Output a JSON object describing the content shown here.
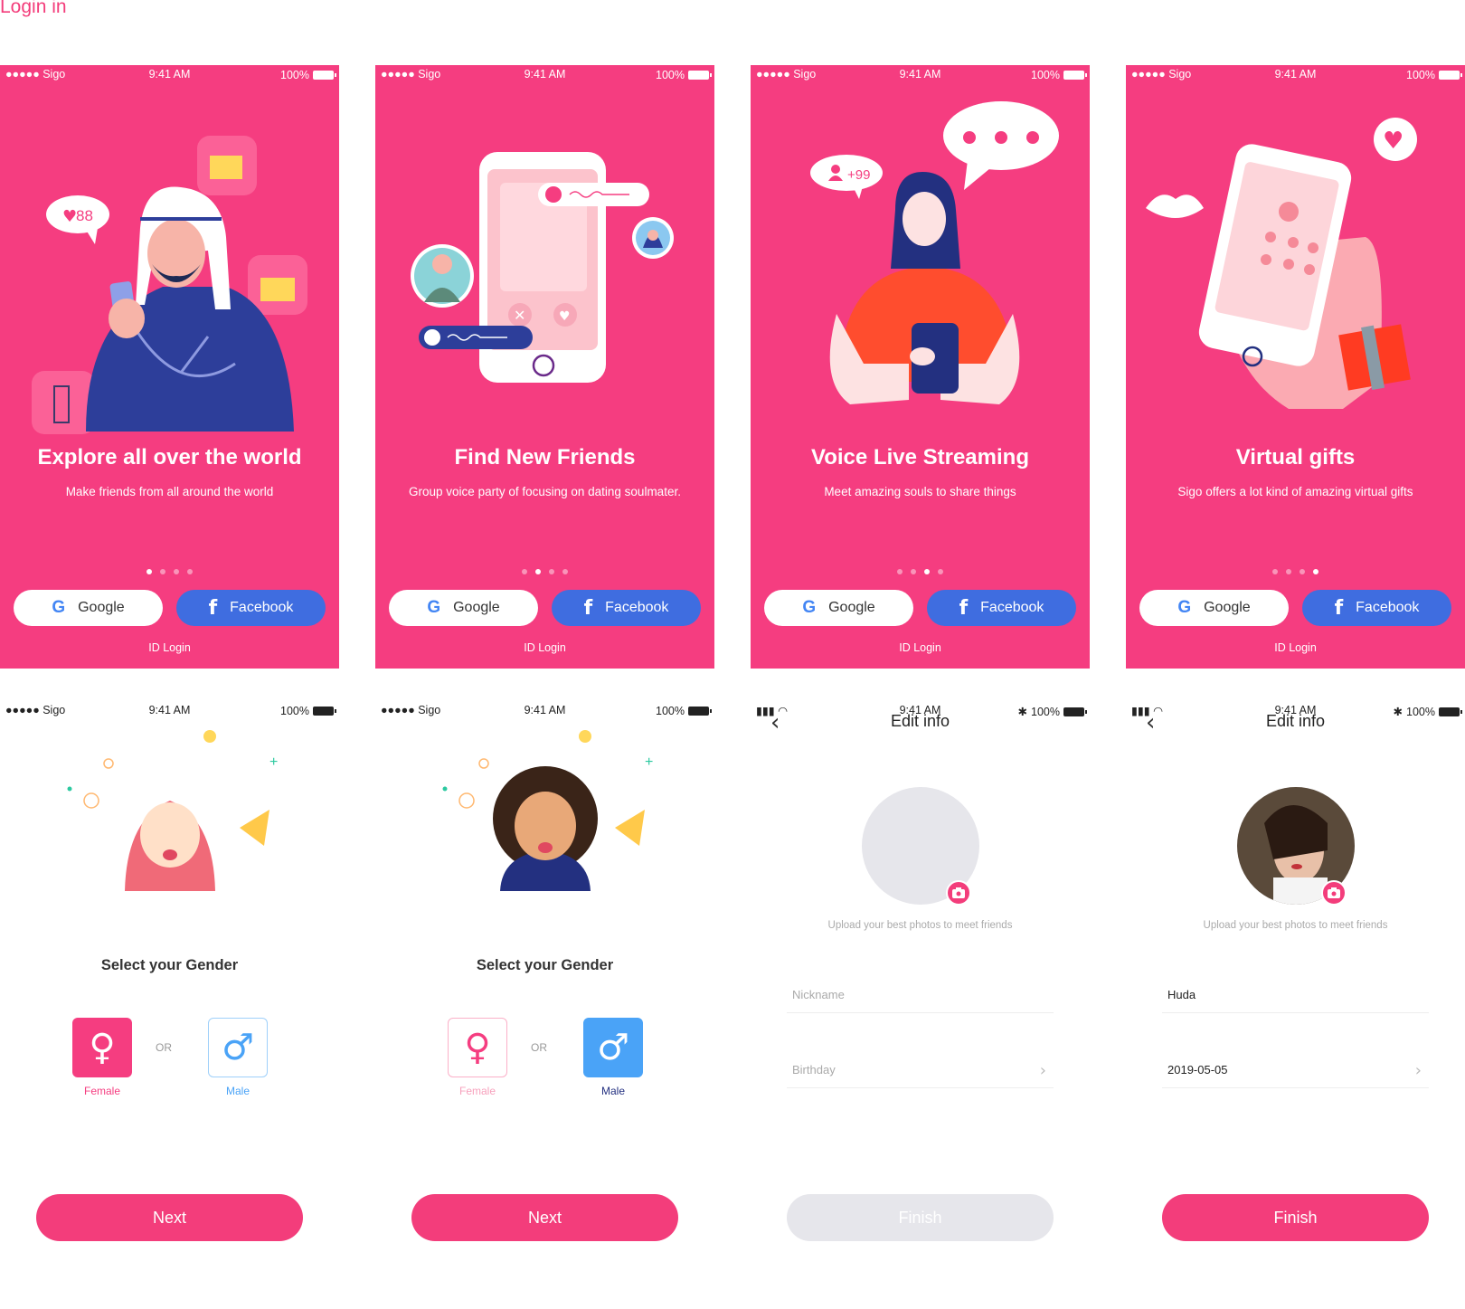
{
  "page_title": "Login in",
  "colors": {
    "brand_pink": "#f53d80",
    "facebook_blue": "#3f6de0",
    "male_blue": "#4aa3f7"
  },
  "status": {
    "carrier": "●●●●● Sigo",
    "time": "9:41 AM",
    "battery": "100%"
  },
  "onboarding": [
    {
      "title": "Explore all over the world",
      "subtitle": "Make friends from all around the world",
      "active_dot": 0,
      "bubble": "88"
    },
    {
      "title": "Find New Friends",
      "subtitle": "Group voice party of focusing on dating soulmater.",
      "active_dot": 1
    },
    {
      "title": "Voice Live Streaming",
      "subtitle": "Meet amazing souls to share things",
      "active_dot": 2,
      "bubble": "+99"
    },
    {
      "title": "Virtual gifts",
      "subtitle": "Sigo offers a lot kind of amazing virtual gifts",
      "active_dot": 3
    }
  ],
  "login": {
    "google": "Google",
    "facebook": "Facebook",
    "id_login": "ID Login"
  },
  "gender": {
    "title": "Select your Gender",
    "or": "OR",
    "female": "Female",
    "male": "Male",
    "female_symbol": "♀",
    "male_symbol": "♂",
    "next": "Next"
  },
  "edit_info": {
    "title": "Edit info",
    "upload_hint": "Upload your best photos to meet friends",
    "nickname_placeholder": "Nickname",
    "birthday_placeholder": "Birthday",
    "nickname_value": "Huda",
    "birthday_value": "2019-05-05",
    "finish": "Finish"
  }
}
